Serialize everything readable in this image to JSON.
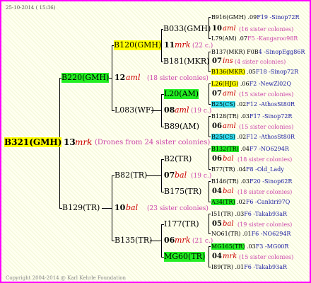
{
  "header": "25-10-2014 ( 15:36)",
  "copyright": "Copyright 2004-2014 @ Karl Kehrle Foundation",
  "root": {
    "name": "B321(GMH)",
    "gen": "13",
    "mark": "mrk",
    "note": "(Drones from 24 sister colonies)"
  },
  "l1": [
    {
      "name": "B220(GMH)",
      "gen": "12",
      "mark": "aml",
      "note": "(18 sister colonies)"
    },
    {
      "name": "B129(TR)",
      "gen": "10",
      "mark": "bal",
      "note": "(23 sister colonies)"
    }
  ],
  "l2": [
    {
      "name": "B120(GMH)",
      "gen": "11",
      "mark": "mrk",
      "note": "(22 c.)"
    },
    {
      "name": "L083(WF)",
      "gen": "08",
      "mark": "aml",
      "note": "(19 c.)"
    },
    {
      "name": "B82(TR)",
      "gen": "07",
      "mark": "bal",
      "note": "(19 c.)"
    },
    {
      "name": "B135(TR)",
      "gen": "06",
      "mark": "mrk",
      "note": "(21 c.)"
    }
  ],
  "l3": [
    {
      "name": "B033(GMH)",
      "gen": "10",
      "mark": "aml",
      "note": "(16 sister colonies)"
    },
    {
      "name": "B181(MKR)",
      "gen": "07",
      "mark": "ins",
      "note": "(4 sister colonies)"
    },
    {
      "name": "L20(AM)",
      "gen": "07",
      "mark": "aml",
      "note": "(15 sister colonies)"
    },
    {
      "name": "B89(AM)",
      "gen": "06",
      "mark": "aml",
      "note": "(15 sister colonies)"
    },
    {
      "name": "B2(TR)",
      "gen": "06",
      "mark": "bal",
      "note": "(18 sister colonies)"
    },
    {
      "name": "B175(TR)",
      "gen": "04",
      "mark": "bal",
      "note": "(18 sister colonies)"
    },
    {
      "name": "I177(TR)",
      "gen": "05",
      "mark": "bal",
      "note": "(19 sister colonies)"
    },
    {
      "name": "MG60(TR)",
      "gen": "04",
      "mark": "mrk",
      "note": "(15 sister colonies)"
    }
  ],
  "l4": [
    {
      "name": "B916(GMH)",
      "yr": ".09",
      "code": "F19 -Sinop72R"
    },
    {
      "name": "L79(AM)",
      "yr": ".07",
      "code": "F5 -Kangaroo98R"
    },
    {
      "name": "B137(MKR)",
      "yr": "F0B",
      "code": "4 -SinopEgg86R"
    },
    {
      "name": "B136(MKR)",
      "yr": ".05",
      "code": "F18 -Sinop72R"
    },
    {
      "name": "L26(HJG)",
      "yr": ".06",
      "code": "F2 -NewZl02Q"
    },
    {
      "name": "B25(CS)",
      "yr": ".02",
      "code": "F12 -AthosSt80R"
    },
    {
      "name": "B128(TR)",
      "yr": ".03",
      "code": "F17 -Sinop72R"
    },
    {
      "name": "B25(CS)",
      "yr": ".02",
      "code": "F12 -AthosSt80R"
    },
    {
      "name": "B132(TR)",
      "yr": ".04",
      "code": "F7 -NO6294R"
    },
    {
      "name": "B77(TR)",
      "yr": ".04",
      "code": "F8 -Old_Lady"
    },
    {
      "name": "B146(TR)",
      "yr": ".03",
      "code": "F20 -Sinop62R"
    },
    {
      "name": "A34(TR)",
      "yr": ".02",
      "code": "F6 -Cankiri97Q"
    },
    {
      "name": "I51(TR)",
      "yr": ".03",
      "code": "F6 -Takab93aR"
    },
    {
      "name": "NO61(TR)",
      "yr": ".01",
      "code": "F6 -NO6294R"
    },
    {
      "name": "MG165(TR)",
      "yr": ".03",
      "code": "F3 -MG00R"
    },
    {
      "name": "I89(TR)",
      "yr": ".01",
      "code": "F6 -Takab93aR"
    }
  ]
}
